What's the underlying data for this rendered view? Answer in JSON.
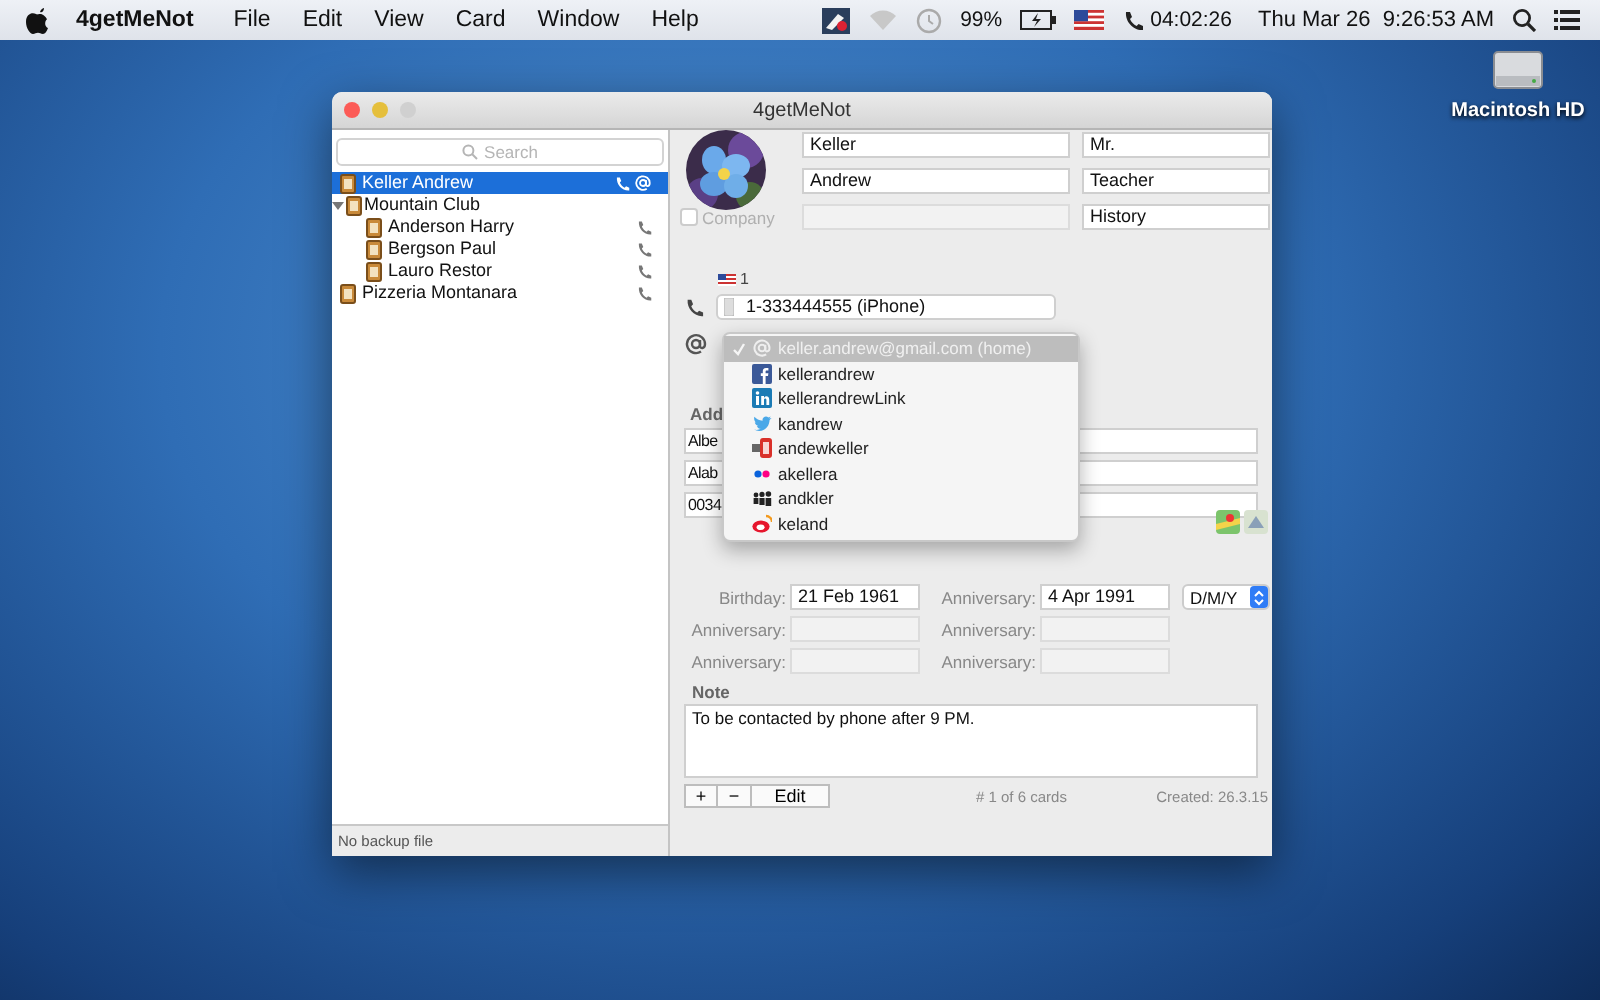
{
  "menubar": {
    "app": "4getMeNot",
    "menus": [
      "File",
      "Edit",
      "View",
      "Card",
      "Window",
      "Help"
    ],
    "battery": "99%",
    "timer": "04:02:26",
    "clock": "Thu Mar 26  9:26:53 AM"
  },
  "desktop_icons": [
    {
      "label": "Macintosh HD"
    }
  ],
  "window": {
    "title": "4getMeNot"
  },
  "sidebar": {
    "search_placeholder": "Search",
    "items": [
      {
        "name": "Keller Andrew",
        "selected": true,
        "phone": true,
        "email": true
      },
      {
        "name": "Mountain Club",
        "selected": false,
        "phone": false,
        "email": false,
        "expanded": true,
        "children": [
          {
            "name": "Anderson Harry",
            "selected": false,
            "phone": true,
            "email": false
          },
          {
            "name": "Bergson Paul",
            "selected": false,
            "phone": true,
            "email": false
          },
          {
            "name": "Lauro Restor",
            "selected": false,
            "phone": true,
            "email": false
          }
        ]
      },
      {
        "name": "Pizzeria Montanara",
        "selected": false,
        "phone": true,
        "email": false
      }
    ],
    "status": "No backup file"
  },
  "card": {
    "last_name": "Keller",
    "title": "Mr.",
    "first_name": "Andrew",
    "job": "Teacher",
    "company_label": "Company",
    "company_checked": false,
    "department": "History",
    "phone": {
      "country_code": "1",
      "number": "1-333444555 (iPhone)"
    },
    "online_menu": [
      {
        "kind": "email",
        "text": "keller.andrew@gmail.com (home)",
        "selected": true
      },
      {
        "kind": "facebook",
        "text": "kellerandrew",
        "selected": false
      },
      {
        "kind": "linkedin",
        "text": "kellerandrewLink",
        "selected": false
      },
      {
        "kind": "twitter",
        "text": "kandrew",
        "selected": false
      },
      {
        "kind": "youtube",
        "text": "andewkeller",
        "selected": false
      },
      {
        "kind": "flickr",
        "text": "akellera",
        "selected": false
      },
      {
        "kind": "myspace",
        "text": "andkler",
        "selected": false
      },
      {
        "kind": "weibo",
        "text": "keland",
        "selected": false
      }
    ],
    "address": {
      "label": "Add",
      "lines": [
        "Albe",
        "Alab",
        "0034"
      ]
    },
    "dates": [
      {
        "label": "Birthday:",
        "value": "21 Feb 1961"
      },
      {
        "label": "Anniversary:",
        "value": "4 Apr 1991"
      },
      {
        "label": "Anniversary:"
      },
      {
        "label": "Anniversary:"
      },
      {
        "label": "Anniversary:"
      },
      {
        "label": "Anniversary:"
      }
    ],
    "date_format": "D/M/Y",
    "note": {
      "label": "Note",
      "text": "To be contacted by phone after 9 PM."
    }
  },
  "footer": {
    "buttons": [
      "+",
      "−",
      "Edit"
    ],
    "count": "# 1 of 6 cards",
    "created": "Created: 26.3.15"
  }
}
